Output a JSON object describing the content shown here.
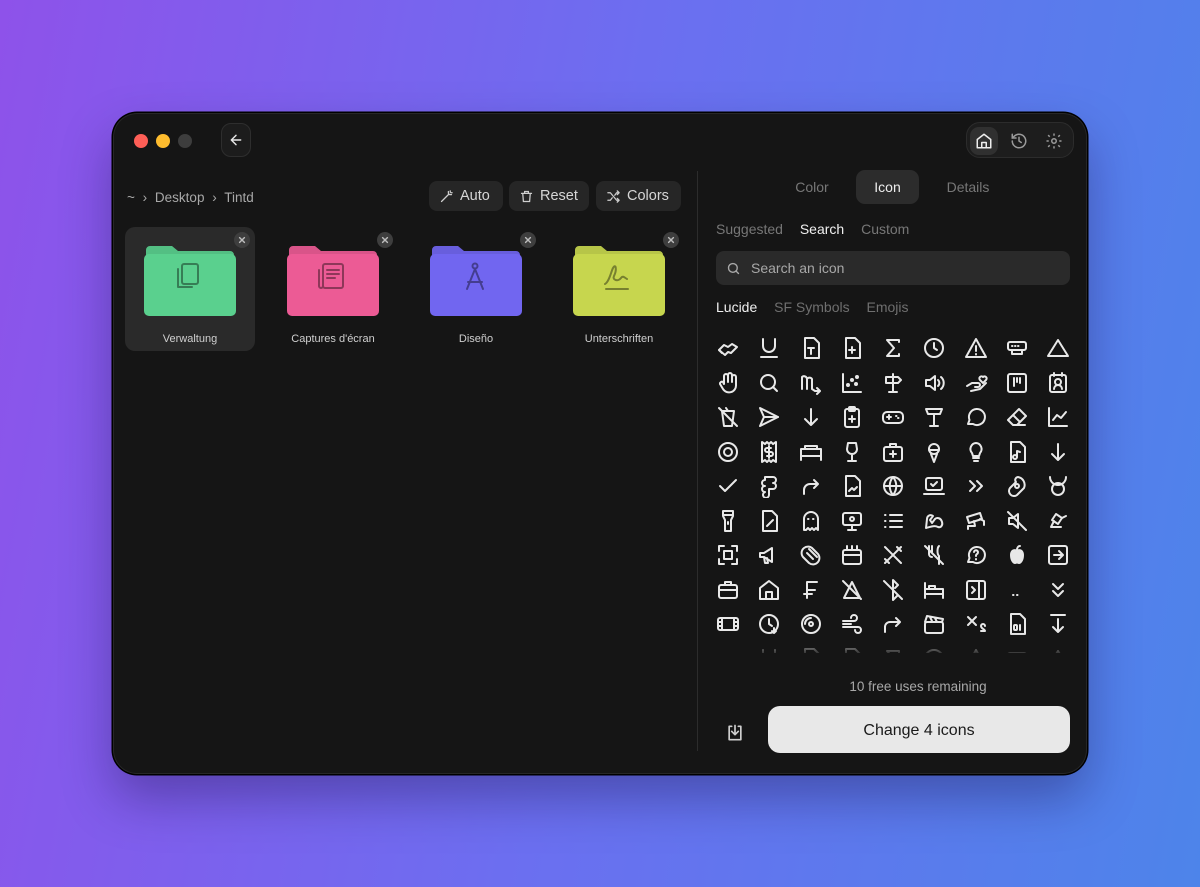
{
  "titlebar": {
    "traffic_lights": [
      "close",
      "minimize",
      "zoom"
    ],
    "back_icon": "arrow-left-icon",
    "nav_icons": [
      "home-icon",
      "history-icon",
      "gear-icon"
    ],
    "active_nav": "home-icon"
  },
  "breadcrumb": [
    "~",
    "Desktop",
    "Tintd"
  ],
  "breadcrumb_separator": "›",
  "toolbar": {
    "auto_label": "Auto",
    "reset_label": "Reset",
    "colors_label": "Colors"
  },
  "folders": [
    {
      "label": "Verwaltung",
      "color": "#5ad08e",
      "glyph": "files-icon",
      "selected": true
    },
    {
      "label": "Captures d'écran",
      "color": "#ec5b95",
      "glyph": "newspaper-icon",
      "selected": false
    },
    {
      "label": "Diseño",
      "color": "#7166f0",
      "glyph": "drafting-compass-icon",
      "selected": false
    },
    {
      "label": "Unterschriften",
      "color": "#c7d64e",
      "glyph": "signature-icon",
      "selected": false
    }
  ],
  "tabs": [
    {
      "label": "Color",
      "active": false
    },
    {
      "label": "Icon",
      "active": true
    },
    {
      "label": "Details",
      "active": false
    }
  ],
  "subtabs": [
    {
      "label": "Suggested",
      "active": false
    },
    {
      "label": "Search",
      "active": true
    },
    {
      "label": "Custom",
      "active": false
    }
  ],
  "search": {
    "placeholder": "Search an icon",
    "value": ""
  },
  "library_tabs": [
    {
      "label": "Lucide",
      "active": true
    },
    {
      "label": "SF Symbols",
      "active": false
    },
    {
      "label": "Emojis",
      "active": false
    }
  ],
  "icon_grid": [
    "handshake",
    "underline",
    "file-type",
    "file-plus",
    "sigma",
    "clock",
    "alert-triangle",
    "router",
    "triangle",
    "hand",
    "search",
    "scorpio",
    "scatter-chart",
    "signpost",
    "volume",
    "hand-heart",
    "kanban",
    "contact",
    "no-drinks",
    "send",
    "arrow-down",
    "clipboard-plus",
    "gamepad",
    "table-lamp",
    "message-circle",
    "eraser",
    "line-chart",
    "target",
    "receipt",
    "bed",
    "wine",
    "medical-bag",
    "ice-cream",
    "lightbulb",
    "file-audio",
    "arrow-down",
    "check",
    "figma",
    "corner-up",
    "file-chart",
    "globe",
    "laptop-check",
    "chevrons-right",
    "ham",
    "taurus",
    "flashlight",
    "pen-file",
    "ghost",
    "presentation",
    "list",
    "biceps",
    "cctv",
    "volume-x",
    "lamp-desk",
    "scan",
    "megaphone",
    "croissant",
    "calendar-box",
    "pen-cross",
    "utensils-off",
    "help-circle",
    "apple",
    "log-in",
    "briefcase",
    "home",
    "franc",
    "pen-off",
    "bluetooth-off",
    "bed-single",
    "panel-right",
    "dots",
    "chevrons-down",
    "film",
    "clock-down",
    "disc",
    "wind",
    "forward",
    "clapperboard",
    "subscript",
    "file-digit",
    "arrow-down-from-line"
  ],
  "uses_remaining": "10 free uses remaining",
  "download_icon": "download-icon",
  "change_button_label": "Change 4 icons"
}
